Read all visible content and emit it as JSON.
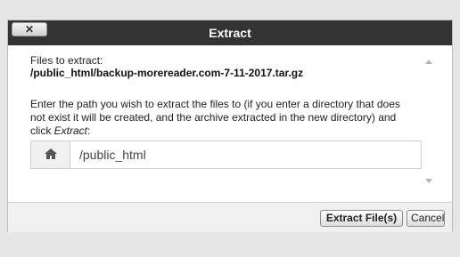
{
  "dialog": {
    "title": "Extract",
    "close_label": "✕"
  },
  "content": {
    "files_label": "Files to extract:",
    "file_path": "/public_html/backup-morereader.com-7-11-2017.tar.gz",
    "description_part1": "Enter the path you wish to extract the files to (if you enter a directory that does not exist it will be created, and the archive extracted in the new directory) and click ",
    "description_emphasis": "Extract",
    "description_part2": ":",
    "path_value": "/public_html",
    "path_icon": "home-icon"
  },
  "footer": {
    "extract_label": "Extract File(s)",
    "cancel_label": "Cancel"
  },
  "colors": {
    "titlebar": "#333333",
    "background": "#e6e6e6",
    "footer": "#f0f0f0"
  }
}
